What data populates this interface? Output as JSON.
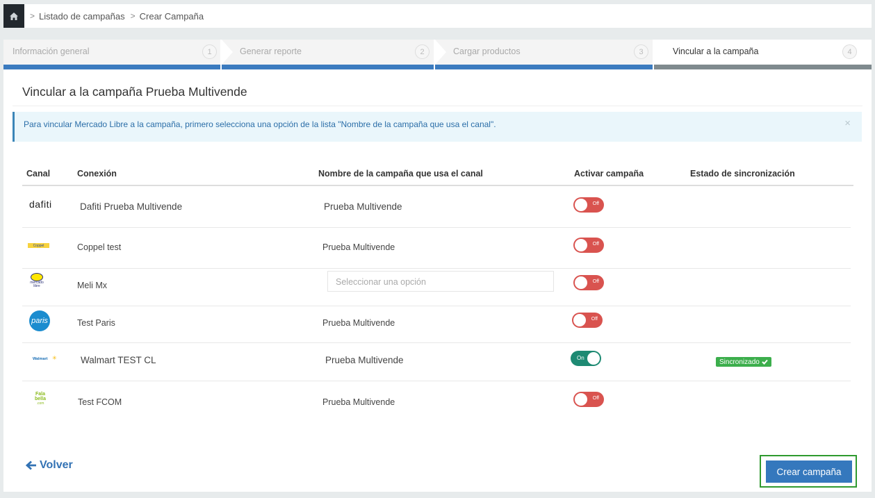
{
  "breadcrumb": {
    "items": [
      "Listado de campañas",
      "Crear Campaña"
    ]
  },
  "steps": [
    {
      "label": "Información general",
      "number": "1"
    },
    {
      "label": "Generar reporte",
      "number": "2"
    },
    {
      "label": "Cargar productos",
      "number": "3"
    },
    {
      "label": "Vincular a la campaña",
      "number": "4"
    }
  ],
  "title": "Vincular a la campaña Prueba Multivende",
  "alert": {
    "text": "Para vincular Mercado Libre a la campaña, primero selecciona una opción de la lista \"Nombre de la campaña que usa el canal\".",
    "close": "×"
  },
  "table": {
    "headers": [
      "Canal",
      "Conexión",
      "Nombre de la campaña que usa el canal",
      "Activar campaña",
      "Estado de sincronización"
    ],
    "rows": [
      {
        "channel_logo": "dafiti",
        "connection": "Dafiti Prueba Multivende",
        "campaign": "Prueba Multivende",
        "toggle": "Off"
      },
      {
        "channel_logo": "coppel",
        "connection": "Coppel test",
        "campaign": "Prueba Multivende",
        "toggle": "Off"
      },
      {
        "channel_logo": "mercadolibre",
        "connection": "Meli Mx",
        "campaign_placeholder": "Seleccionar una opción",
        "toggle": "Off"
      },
      {
        "channel_logo": "paris",
        "connection": "Test Paris",
        "campaign": "Prueba Multivende",
        "toggle": "Off"
      },
      {
        "channel_logo": "walmart",
        "connection": "Walmart TEST CL",
        "campaign": "Prueba Multivende",
        "toggle": "On",
        "sync": "Sincronizado"
      },
      {
        "channel_logo": "falabella",
        "connection": "Test FCOM",
        "campaign": "Prueba Multivende",
        "toggle": "Off"
      }
    ]
  },
  "logos": {
    "dafiti": "dafiti",
    "coppel": "Coppel",
    "meli_line1": "mercado",
    "meli_line2": "libre",
    "paris": "paris",
    "walmart": "Walmart",
    "falabella_1": "Fala",
    "falabella_2": "bella",
    "falabella_3": ".com"
  },
  "footer": {
    "back": "Volver",
    "create": "Crear campaña"
  },
  "colors": {
    "accent": "#3578bd",
    "toggle_off": "#d9534f",
    "toggle_on": "#1e8a73",
    "sync": "#3cae4c"
  }
}
